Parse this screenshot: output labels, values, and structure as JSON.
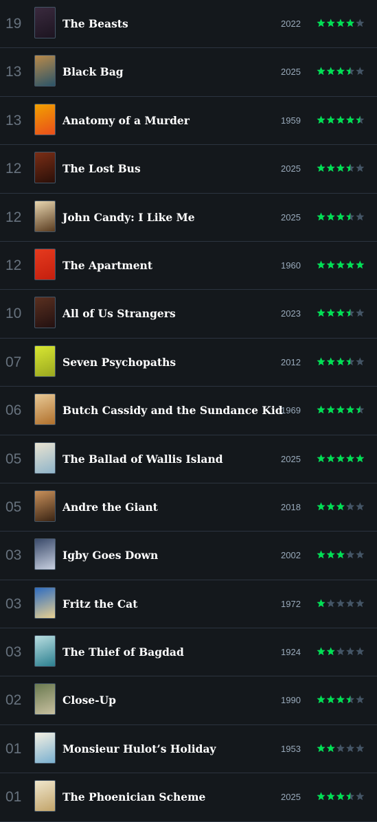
{
  "colors": {
    "background": "#14181c",
    "divider": "#2c3440",
    "star_on": "#00e054",
    "star_off": "#445566",
    "day_text": "#67727e",
    "year_text": "#99aabb"
  },
  "diary": [
    {
      "day": "19",
      "title": "The Beasts",
      "year": "2022",
      "rating": 4,
      "poster": [
        "#3a2a3e",
        "#1c1420"
      ]
    },
    {
      "day": "13",
      "title": "Black Bag",
      "year": "2025",
      "rating": 3.5,
      "poster": [
        "#b98a4a",
        "#2b5468"
      ]
    },
    {
      "day": "13",
      "title": "Anatomy of a Murder",
      "year": "1959",
      "rating": 4.5,
      "poster": [
        "#f2a100",
        "#e94e1b"
      ]
    },
    {
      "day": "12",
      "title": "The Lost Bus",
      "year": "2025",
      "rating": 3.5,
      "poster": [
        "#7a2e16",
        "#2a0f08"
      ]
    },
    {
      "day": "12",
      "title": "John Candy: I Like Me",
      "year": "2025",
      "rating": 3.5,
      "poster": [
        "#e8d6b0",
        "#5a3c20"
      ]
    },
    {
      "day": "12",
      "title": "The Apartment",
      "year": "1960",
      "rating": 5,
      "poster": [
        "#e53a1e",
        "#c41f0e"
      ]
    },
    {
      "day": "10",
      "title": "All of Us Strangers",
      "year": "2023",
      "rating": 3.5,
      "poster": [
        "#5a3020",
        "#221010"
      ]
    },
    {
      "day": "07",
      "title": "Seven Psychopaths",
      "year": "2012",
      "rating": 3.5,
      "poster": [
        "#d8e632",
        "#9aa820"
      ]
    },
    {
      "day": "06",
      "title": "Butch Cassidy and the Sundance Kid",
      "year": "1969",
      "rating": 4.5,
      "poster": [
        "#e8c996",
        "#b0702c"
      ]
    },
    {
      "day": "05",
      "title": "The Ballad of Wallis Island",
      "year": "2025",
      "rating": 5,
      "poster": [
        "#e9e3d1",
        "#8fb4c9"
      ]
    },
    {
      "day": "05",
      "title": "Andre the Giant",
      "year": "2018",
      "rating": 3,
      "poster": [
        "#c8905a",
        "#3a2414"
      ]
    },
    {
      "day": "03",
      "title": "Igby Goes Down",
      "year": "2002",
      "rating": 3,
      "poster": [
        "#3a4a6a",
        "#c8d0e0"
      ]
    },
    {
      "day": "03",
      "title": "Fritz the Cat",
      "year": "1972",
      "rating": 1,
      "poster": [
        "#2e6cc0",
        "#e8d090"
      ]
    },
    {
      "day": "03",
      "title": "The Thief of Bagdad",
      "year": "1924",
      "rating": 2,
      "poster": [
        "#b9dde0",
        "#2c8090"
      ]
    },
    {
      "day": "02",
      "title": "Close-Up",
      "year": "1990",
      "rating": 3.5,
      "poster": [
        "#6a7a50",
        "#c8c0a0"
      ]
    },
    {
      "day": "01",
      "title": "Monsieur Hulot’s Holiday",
      "year": "1953",
      "rating": 2,
      "poster": [
        "#f4f0e2",
        "#7ab0d0"
      ]
    },
    {
      "day": "01",
      "title": "The Phoenician Scheme",
      "year": "2025",
      "rating": 3.5,
      "poster": [
        "#efe6cc",
        "#c2a46a"
      ]
    }
  ]
}
